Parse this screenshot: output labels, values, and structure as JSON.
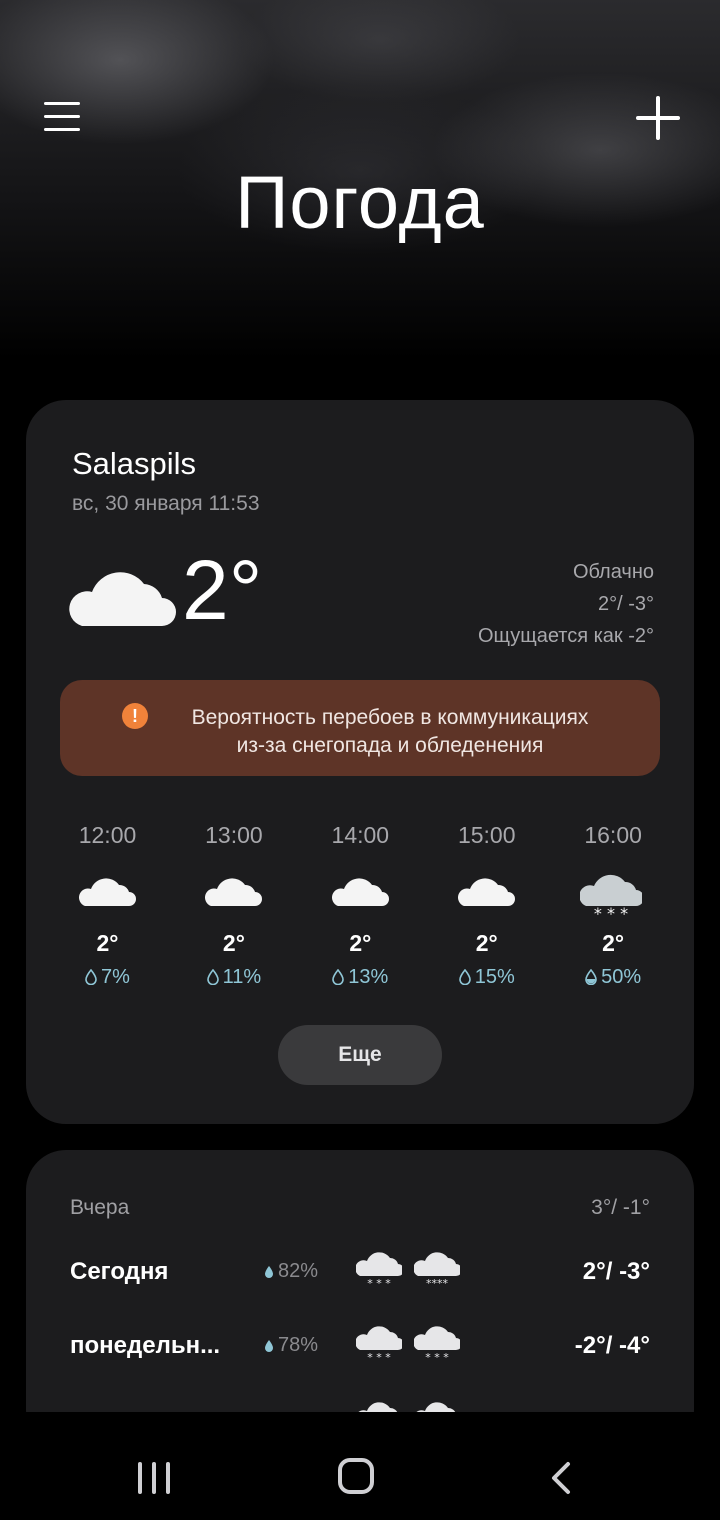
{
  "header": {
    "title": "Погода",
    "menu_icon": "hamburger-menu-icon",
    "add_icon": "plus-icon"
  },
  "current": {
    "city": "Salaspils",
    "datetime": "вс, 30 января 11:53",
    "temperature": "2°",
    "condition": "Облачно",
    "high_low": "2°/ -3°",
    "feels_like": "Ощущается как -2°",
    "icon": "cloud-icon"
  },
  "alert": {
    "icon": "exclamation-icon",
    "color": "#5e3427",
    "line1": "Вероятность перебоев в коммуникациях",
    "line2": "из-за снегопада и обледенения"
  },
  "hourly": [
    {
      "time": "12:00",
      "icon": "cloud-icon",
      "temp": "2°",
      "precip": "7%"
    },
    {
      "time": "13:00",
      "icon": "cloud-icon",
      "temp": "2°",
      "precip": "11%"
    },
    {
      "time": "14:00",
      "icon": "cloud-icon",
      "temp": "2°",
      "precip": "13%"
    },
    {
      "time": "15:00",
      "icon": "cloud-icon",
      "temp": "2°",
      "precip": "15%"
    },
    {
      "time": "16:00",
      "icon": "snow-cloud-icon",
      "temp": "2°",
      "precip": "50%"
    }
  ],
  "more_label": "Еще",
  "daily": {
    "yesterday": {
      "label": "Вчера",
      "temps": "3°/ -1°"
    },
    "rows": [
      {
        "day": "Сегодня",
        "precip": "82%",
        "icons": [
          "snow-cloud-icon",
          "snow-cloud-icon"
        ],
        "temps": "2°/ -3°"
      },
      {
        "day": "понедельн...",
        "precip": "78%",
        "icons": [
          "snow-cloud-icon",
          "snow-cloud-icon"
        ],
        "temps": "-2°/ -4°"
      }
    ]
  },
  "nav": {
    "recents_icon": "recent-apps-icon",
    "home_icon": "home-icon",
    "back_icon": "back-icon"
  },
  "colors": {
    "card_bg": "#1c1c1e",
    "alert_bg": "#5e3427",
    "precip_blue": "#8fc6d6",
    "alert_icon": "#f0823a"
  }
}
